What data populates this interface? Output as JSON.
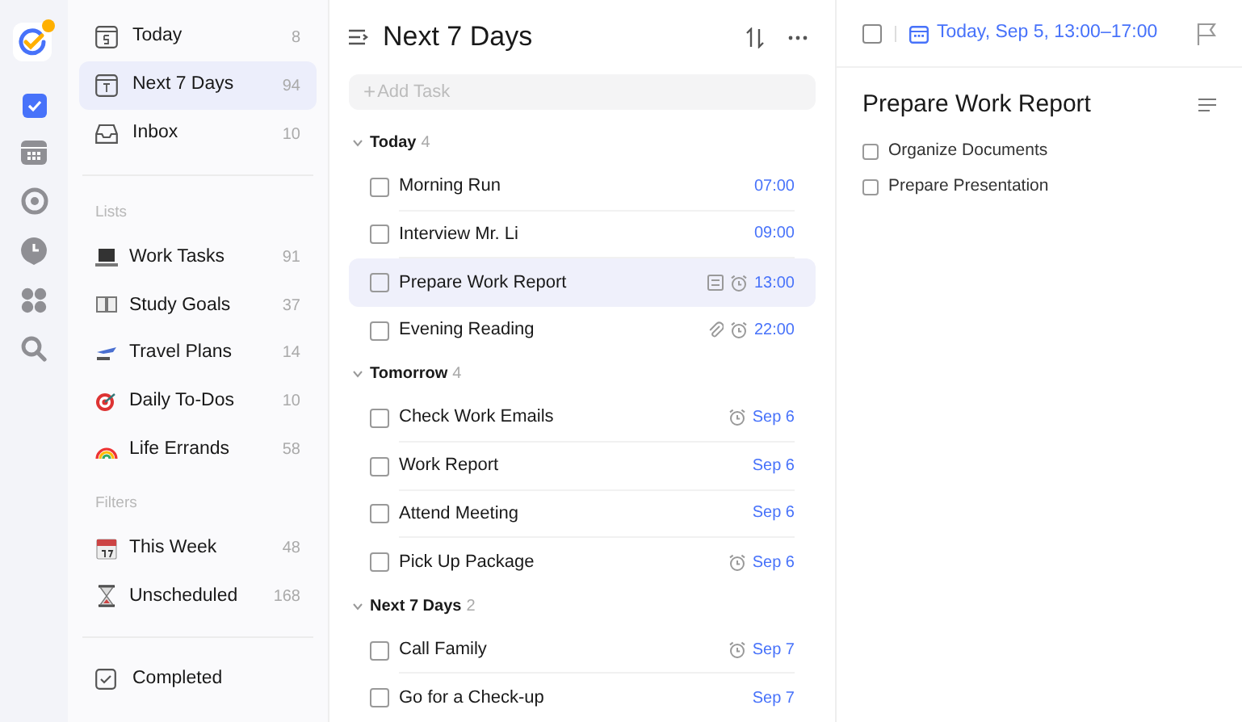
{
  "nav": [
    {
      "label": "Today",
      "count": "8",
      "selected": false
    },
    {
      "label": "Next 7 Days",
      "count": "94",
      "selected": true
    },
    {
      "label": "Inbox",
      "count": "10",
      "selected": false
    }
  ],
  "lists": {
    "heading": "Lists",
    "items": [
      {
        "label": "Work Tasks",
        "count": "91"
      },
      {
        "label": "Study Goals",
        "count": "37"
      },
      {
        "label": "Travel Plans",
        "count": "14"
      },
      {
        "label": "Daily To-Dos",
        "count": "10"
      },
      {
        "label": "Life Errands",
        "count": "58"
      }
    ]
  },
  "filters": {
    "heading": "Filters",
    "items": [
      {
        "label": "This Week",
        "count": "48"
      },
      {
        "label": "Unscheduled",
        "count": "168"
      }
    ]
  },
  "completed": {
    "label": "Completed"
  },
  "main": {
    "title": "Next 7 Days",
    "add_placeholder": "Add Task",
    "add_plus": "+",
    "groups": [
      {
        "title": "Today",
        "count": "4",
        "expanded": true,
        "tasks": [
          {
            "title": "Morning Run",
            "date": "07:00",
            "note": false,
            "attachment": false,
            "alarm": false,
            "selected": false
          },
          {
            "title": "Interview Mr. Li",
            "date": "09:00",
            "note": false,
            "attachment": false,
            "alarm": false,
            "selected": false
          },
          {
            "title": "Prepare Work Report",
            "date": "13:00",
            "note": true,
            "attachment": false,
            "alarm": true,
            "selected": true
          },
          {
            "title": "Evening Reading",
            "date": "22:00",
            "note": false,
            "attachment": true,
            "alarm": true,
            "selected": false
          }
        ]
      },
      {
        "title": "Tomorrow",
        "count": "4",
        "expanded": true,
        "tasks": [
          {
            "title": "Check Work Emails",
            "date": "Sep 6",
            "note": false,
            "attachment": false,
            "alarm": true,
            "selected": false
          },
          {
            "title": "Work Report",
            "date": "Sep 6",
            "note": false,
            "attachment": false,
            "alarm": false,
            "selected": false
          },
          {
            "title": "Attend Meeting",
            "date": "Sep 6",
            "note": false,
            "attachment": false,
            "alarm": false,
            "selected": false
          },
          {
            "title": "Pick Up Package",
            "date": "Sep 6",
            "note": false,
            "attachment": false,
            "alarm": true,
            "selected": false
          }
        ]
      },
      {
        "title": "Next 7 Days",
        "count": "2",
        "expanded": true,
        "tasks": [
          {
            "title": "Call Family",
            "date": "Sep 7",
            "note": false,
            "attachment": false,
            "alarm": true,
            "selected": false
          },
          {
            "title": "Go for a Check-up",
            "date": "Sep 7",
            "note": false,
            "attachment": false,
            "alarm": false,
            "selected": false
          }
        ]
      }
    ]
  },
  "detail": {
    "date": "Today, Sep 5, 13:00–17:00",
    "checked": false,
    "title": "Prepare Work Report",
    "subtasks": [
      {
        "title": "Organize Documents",
        "checked": false
      },
      {
        "title": "Prepare Presentation",
        "checked": false
      }
    ]
  }
}
